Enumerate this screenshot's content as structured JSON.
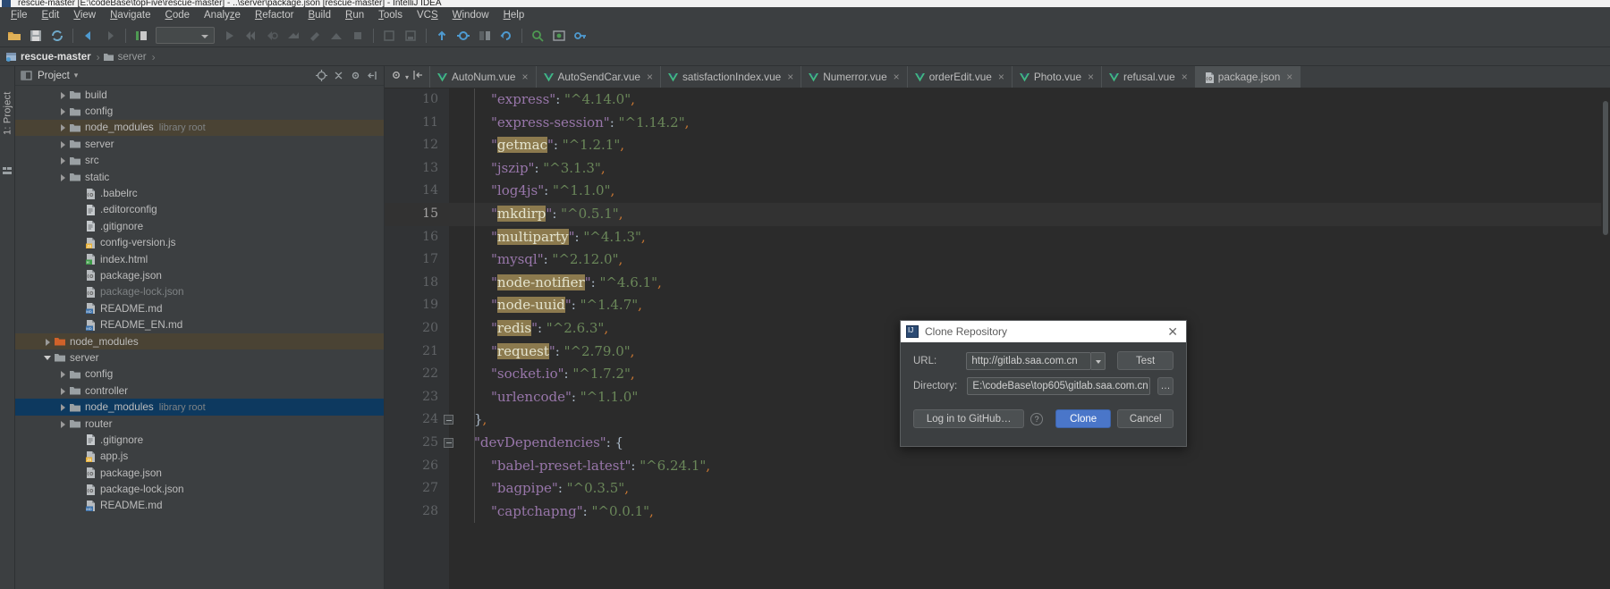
{
  "window": {
    "title": "rescue-master [E:\\codeBase\\topFive\\rescue-master] - ..\\server\\package.json [rescue-master] - IntelliJ IDEA"
  },
  "menubar": {
    "items": [
      {
        "label": "File",
        "mnemonic": "F"
      },
      {
        "label": "Edit",
        "mnemonic": "E"
      },
      {
        "label": "View",
        "mnemonic": "V"
      },
      {
        "label": "Navigate",
        "mnemonic": "N"
      },
      {
        "label": "Code",
        "mnemonic": "C"
      },
      {
        "label": "Analyze",
        "mnemonic": "z"
      },
      {
        "label": "Refactor",
        "mnemonic": "R"
      },
      {
        "label": "Build",
        "mnemonic": "B"
      },
      {
        "label": "Run",
        "mnemonic": "R"
      },
      {
        "label": "Tools",
        "mnemonic": "T"
      },
      {
        "label": "VCS",
        "mnemonic": "S"
      },
      {
        "label": "Window",
        "mnemonic": "W"
      },
      {
        "label": "Help",
        "mnemonic": "H"
      }
    ]
  },
  "toolbar": {
    "run_config_value": "",
    "icons": [
      "open-project-icon",
      "save-all-icon",
      "sync-icon",
      "back-icon",
      "forward-icon",
      "toggle-bookmark-icon",
      "run-icon",
      "debug-icon",
      "run-coverage-icon",
      "profile-icon",
      "attach-icon",
      "build-icon",
      "stop-icon",
      "settings-icon",
      "project-structure-icon",
      "update-project-icon",
      "commit-icon",
      "compare-icon",
      "rollback-icon",
      "search-everywhere-icon",
      "find-icon",
      "key-icon"
    ]
  },
  "breadcrumb": {
    "items": [
      {
        "label": "rescue-master",
        "icon": "project-module-icon",
        "root": true
      },
      {
        "label": "server",
        "icon": "folder-icon",
        "root": false
      }
    ],
    "separator": "›"
  },
  "left_strip": {
    "tab_label": "1: Project",
    "icon": "structure-icon"
  },
  "project_panel": {
    "title": "Project",
    "dropdown_caret": "▾",
    "header_icons": [
      "locate-icon",
      "expand-collapse-icon",
      "settings-gear-icon",
      "hide-icon"
    ],
    "tree": [
      {
        "label": "build",
        "sub": "",
        "icon": "folder-icon",
        "arrow": "closed",
        "indent": 2,
        "state": "normal"
      },
      {
        "label": "config",
        "sub": "",
        "icon": "folder-icon",
        "arrow": "closed",
        "indent": 2,
        "state": "normal"
      },
      {
        "label": "node_modules",
        "sub": "library root",
        "icon": "folder-icon",
        "arrow": "closed",
        "indent": 2,
        "state": "libroot"
      },
      {
        "label": "server",
        "sub": "",
        "icon": "folder-icon",
        "arrow": "closed",
        "indent": 2,
        "state": "normal"
      },
      {
        "label": "src",
        "sub": "",
        "icon": "folder-icon",
        "arrow": "closed",
        "indent": 2,
        "state": "normal"
      },
      {
        "label": "static",
        "sub": "",
        "icon": "folder-icon",
        "arrow": "closed",
        "indent": 2,
        "state": "normal"
      },
      {
        "label": ".babelrc",
        "sub": "",
        "icon": "json-file-icon",
        "arrow": "none",
        "indent": 3,
        "state": "normal"
      },
      {
        "label": ".editorconfig",
        "sub": "",
        "icon": "text-file-icon",
        "arrow": "none",
        "indent": 3,
        "state": "normal"
      },
      {
        "label": ".gitignore",
        "sub": "",
        "icon": "text-file-icon",
        "arrow": "none",
        "indent": 3,
        "state": "normal"
      },
      {
        "label": "config-version.js",
        "sub": "",
        "icon": "js-file-icon",
        "arrow": "none",
        "indent": 3,
        "state": "normal"
      },
      {
        "label": "index.html",
        "sub": "",
        "icon": "html-file-icon",
        "arrow": "none",
        "indent": 3,
        "state": "normal"
      },
      {
        "label": "package.json",
        "sub": "",
        "icon": "json-file-icon",
        "arrow": "none",
        "indent": 3,
        "state": "normal"
      },
      {
        "label": "package-lock.json",
        "sub": "",
        "icon": "json-file-icon",
        "arrow": "none",
        "indent": 3,
        "state": "muted"
      },
      {
        "label": "README.md",
        "sub": "",
        "icon": "md-file-icon",
        "arrow": "none",
        "indent": 3,
        "state": "normal"
      },
      {
        "label": "README_EN.md",
        "sub": "",
        "icon": "md-file-icon",
        "arrow": "none",
        "indent": 3,
        "state": "normal"
      },
      {
        "label": "node_modules",
        "sub": "",
        "icon": "folder-orange-icon",
        "arrow": "closed",
        "indent": 1,
        "state": "libroot"
      },
      {
        "label": "server",
        "sub": "",
        "icon": "folder-icon",
        "arrow": "open",
        "indent": 1,
        "state": "normal"
      },
      {
        "label": "config",
        "sub": "",
        "icon": "folder-icon",
        "arrow": "closed",
        "indent": 2,
        "state": "normal"
      },
      {
        "label": "controller",
        "sub": "",
        "icon": "folder-icon",
        "arrow": "closed",
        "indent": 2,
        "state": "normal"
      },
      {
        "label": "node_modules",
        "sub": "library root",
        "icon": "folder-icon",
        "arrow": "closed",
        "indent": 2,
        "state": "selected"
      },
      {
        "label": "router",
        "sub": "",
        "icon": "folder-icon",
        "arrow": "closed",
        "indent": 2,
        "state": "normal"
      },
      {
        "label": ".gitignore",
        "sub": "",
        "icon": "text-file-icon",
        "arrow": "none",
        "indent": 3,
        "state": "normal"
      },
      {
        "label": "app.js",
        "sub": "",
        "icon": "js-file-icon",
        "arrow": "none",
        "indent": 3,
        "state": "normal"
      },
      {
        "label": "package.json",
        "sub": "",
        "icon": "json-file-icon",
        "arrow": "none",
        "indent": 3,
        "state": "normal"
      },
      {
        "label": "package-lock.json",
        "sub": "",
        "icon": "json-file-icon",
        "arrow": "none",
        "indent": 3,
        "state": "normal"
      },
      {
        "label": "README.md",
        "sub": "",
        "icon": "md-file-icon",
        "arrow": "none",
        "indent": 3,
        "state": "normal"
      }
    ]
  },
  "editor": {
    "tab_tools": [
      "settings-gear-icon",
      "collapse-all-icon"
    ],
    "tabs": [
      {
        "label": "AutoNum.vue",
        "icon": "vue-icon",
        "active": false,
        "close": "×"
      },
      {
        "label": "AutoSendCar.vue",
        "icon": "vue-icon",
        "active": false,
        "close": "×"
      },
      {
        "label": "satisfactionIndex.vue",
        "icon": "vue-icon",
        "active": false,
        "close": "×"
      },
      {
        "label": "Numerror.vue",
        "icon": "vue-icon",
        "active": false,
        "close": "×"
      },
      {
        "label": "orderEdit.vue",
        "icon": "vue-icon",
        "active": false,
        "close": "×"
      },
      {
        "label": "Photo.vue",
        "icon": "vue-icon",
        "active": false,
        "close": "×"
      },
      {
        "label": "refusal.vue",
        "icon": "vue-icon",
        "active": false,
        "close": "×"
      },
      {
        "label": "package.json",
        "icon": "json-icon",
        "active": true,
        "close": "×"
      }
    ],
    "lines": [
      {
        "no": "10",
        "indent": 2,
        "highlight": false,
        "fold": "",
        "parts": [
          {
            "t": "\"express\"",
            "c": "tok-key"
          },
          {
            "t": ": ",
            "c": "tok-col"
          },
          {
            "t": "\"^4.14.0\"",
            "c": "tok-str"
          },
          {
            "t": ",",
            "c": "tok-pun"
          }
        ]
      },
      {
        "no": "11",
        "indent": 2,
        "highlight": false,
        "fold": "",
        "parts": [
          {
            "t": "\"express-session\"",
            "c": "tok-key"
          },
          {
            "t": ": ",
            "c": "tok-col"
          },
          {
            "t": "\"^1.14.2\"",
            "c": "tok-str"
          },
          {
            "t": ",",
            "c": "tok-pun"
          }
        ]
      },
      {
        "no": "12",
        "indent": 2,
        "highlight": false,
        "fold": "",
        "parts": [
          {
            "t": "\"",
            "c": "tok-key"
          },
          {
            "t": "getmac",
            "c": "occ"
          },
          {
            "t": "\"",
            "c": "tok-key"
          },
          {
            "t": ": ",
            "c": "tok-col"
          },
          {
            "t": "\"^1.2.1\"",
            "c": "tok-str"
          },
          {
            "t": ",",
            "c": "tok-pun"
          }
        ]
      },
      {
        "no": "13",
        "indent": 2,
        "highlight": false,
        "fold": "",
        "parts": [
          {
            "t": "\"jszip\"",
            "c": "tok-key"
          },
          {
            "t": ": ",
            "c": "tok-col"
          },
          {
            "t": "\"^3.1.3\"",
            "c": "tok-str"
          },
          {
            "t": ",",
            "c": "tok-pun"
          }
        ]
      },
      {
        "no": "14",
        "indent": 2,
        "highlight": false,
        "fold": "",
        "parts": [
          {
            "t": "\"log4js\"",
            "c": "tok-key"
          },
          {
            "t": ": ",
            "c": "tok-col"
          },
          {
            "t": "\"^1.1.0\"",
            "c": "tok-str"
          },
          {
            "t": ",",
            "c": "tok-pun"
          }
        ]
      },
      {
        "no": "15",
        "indent": 2,
        "highlight": true,
        "fold": "",
        "parts": [
          {
            "t": "\"",
            "c": "tok-key"
          },
          {
            "t": "mkdirp",
            "c": "occ"
          },
          {
            "t": "\"",
            "c": "tok-key"
          },
          {
            "t": ": ",
            "c": "tok-col"
          },
          {
            "t": "\"^0.5.1\"",
            "c": "tok-str"
          },
          {
            "t": ",",
            "c": "tok-pun"
          }
        ]
      },
      {
        "no": "16",
        "indent": 2,
        "highlight": false,
        "fold": "",
        "parts": [
          {
            "t": "\"",
            "c": "tok-key"
          },
          {
            "t": "multiparty",
            "c": "occ"
          },
          {
            "t": "\"",
            "c": "tok-key"
          },
          {
            "t": ": ",
            "c": "tok-col"
          },
          {
            "t": "\"^4.1.3\"",
            "c": "tok-str"
          },
          {
            "t": ",",
            "c": "tok-pun"
          }
        ]
      },
      {
        "no": "17",
        "indent": 2,
        "highlight": false,
        "fold": "",
        "parts": [
          {
            "t": "\"mysql\"",
            "c": "tok-key"
          },
          {
            "t": ": ",
            "c": "tok-col"
          },
          {
            "t": "\"^2.12.0\"",
            "c": "tok-str"
          },
          {
            "t": ",",
            "c": "tok-pun"
          }
        ]
      },
      {
        "no": "18",
        "indent": 2,
        "highlight": false,
        "fold": "",
        "parts": [
          {
            "t": "\"",
            "c": "tok-key"
          },
          {
            "t": "node-notifier",
            "c": "occ"
          },
          {
            "t": "\"",
            "c": "tok-key"
          },
          {
            "t": ": ",
            "c": "tok-col"
          },
          {
            "t": "\"^4.6.1\"",
            "c": "tok-str"
          },
          {
            "t": ",",
            "c": "tok-pun"
          }
        ]
      },
      {
        "no": "19",
        "indent": 2,
        "highlight": false,
        "fold": "",
        "parts": [
          {
            "t": "\"",
            "c": "tok-key"
          },
          {
            "t": "node-uuid",
            "c": "occ"
          },
          {
            "t": "\"",
            "c": "tok-key"
          },
          {
            "t": ": ",
            "c": "tok-col"
          },
          {
            "t": "\"^1.4.7\"",
            "c": "tok-str"
          },
          {
            "t": ",",
            "c": "tok-pun"
          }
        ]
      },
      {
        "no": "20",
        "indent": 2,
        "highlight": false,
        "fold": "",
        "parts": [
          {
            "t": "\"",
            "c": "tok-key"
          },
          {
            "t": "redis",
            "c": "occ"
          },
          {
            "t": "\"",
            "c": "tok-key"
          },
          {
            "t": ": ",
            "c": "tok-col"
          },
          {
            "t": "\"^2.6.3\"",
            "c": "tok-str"
          },
          {
            "t": ",",
            "c": "tok-pun"
          }
        ]
      },
      {
        "no": "21",
        "indent": 2,
        "highlight": false,
        "fold": "",
        "parts": [
          {
            "t": "\"",
            "c": "tok-key"
          },
          {
            "t": "request",
            "c": "occ"
          },
          {
            "t": "\"",
            "c": "tok-key"
          },
          {
            "t": ": ",
            "c": "tok-col"
          },
          {
            "t": "\"^2.79.0\"",
            "c": "tok-str"
          },
          {
            "t": ",",
            "c": "tok-pun"
          }
        ]
      },
      {
        "no": "22",
        "indent": 2,
        "highlight": false,
        "fold": "",
        "parts": [
          {
            "t": "\"socket.io\"",
            "c": "tok-key"
          },
          {
            "t": ": ",
            "c": "tok-col"
          },
          {
            "t": "\"^1.7.2\"",
            "c": "tok-str"
          },
          {
            "t": ",",
            "c": "tok-pun"
          }
        ]
      },
      {
        "no": "23",
        "indent": 2,
        "highlight": false,
        "fold": "",
        "parts": [
          {
            "t": "\"urlencode\"",
            "c": "tok-key"
          },
          {
            "t": ": ",
            "c": "tok-col"
          },
          {
            "t": "\"^1.1.0\"",
            "c": "tok-str"
          }
        ]
      },
      {
        "no": "24",
        "indent": 1,
        "highlight": false,
        "fold": "up",
        "parts": [
          {
            "t": "}",
            "c": "tok-col"
          },
          {
            "t": ",",
            "c": "tok-pun"
          }
        ]
      },
      {
        "no": "25",
        "indent": 1,
        "highlight": false,
        "fold": "down",
        "parts": [
          {
            "t": "\"devDependencies\"",
            "c": "tok-key"
          },
          {
            "t": ": ",
            "c": "tok-col"
          },
          {
            "t": "{",
            "c": "tok-col"
          }
        ]
      },
      {
        "no": "26",
        "indent": 2,
        "highlight": false,
        "fold": "",
        "parts": [
          {
            "t": "\"babel-preset-latest\"",
            "c": "tok-key"
          },
          {
            "t": ": ",
            "c": "tok-col"
          },
          {
            "t": "\"^6.24.1\"",
            "c": "tok-str"
          },
          {
            "t": ",",
            "c": "tok-pun"
          }
        ]
      },
      {
        "no": "27",
        "indent": 2,
        "highlight": false,
        "fold": "",
        "parts": [
          {
            "t": "\"bagpipe\"",
            "c": "tok-key"
          },
          {
            "t": ": ",
            "c": "tok-col"
          },
          {
            "t": "\"^0.3.5\"",
            "c": "tok-str"
          },
          {
            "t": ",",
            "c": "tok-pun"
          }
        ]
      },
      {
        "no": "28",
        "indent": 2,
        "highlight": false,
        "fold": "",
        "parts": [
          {
            "t": "\"captchapng\"",
            "c": "tok-key"
          },
          {
            "t": ": ",
            "c": "tok-col"
          },
          {
            "t": "\"^0.0.1\"",
            "c": "tok-str"
          },
          {
            "t": ",",
            "c": "tok-pun"
          }
        ]
      }
    ]
  },
  "dialog": {
    "title": "Clone Repository",
    "icon": "intellij-icon",
    "close_glyph": "✕",
    "url_label": "URL:",
    "url_value": "http://gitlab.saa.com.cn",
    "test_label": "Test",
    "directory_label": "Directory:",
    "directory_value": "E:\\codeBase\\top605\\gitlab.saa.com.cn",
    "browse_label": "…",
    "login_label": "Log in to GitHub…",
    "help_glyph": "?",
    "clone_label": "Clone",
    "cancel_label": "Cancel",
    "accent_color": "#4a76c9"
  },
  "colors": {
    "ide_background": "#3c3f41",
    "editor_background": "#2b2b2b",
    "selection_blue": "#0d395f",
    "library_root": "#4a4334",
    "string_green": "#6a8759",
    "key_purple": "#9876aa",
    "occurrence_olive": "#8c7a4e"
  }
}
